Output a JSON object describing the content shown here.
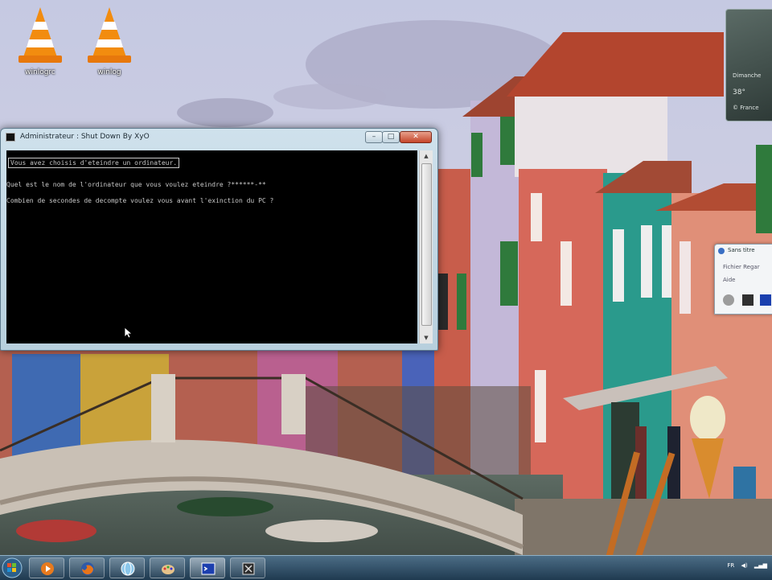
{
  "desktop": {
    "icons": [
      {
        "label": "winlogrc"
      },
      {
        "label": "winlog"
      }
    ]
  },
  "console": {
    "title": "Administrateur : Shut Down By XyO",
    "buttons": {
      "minimize": "–",
      "maximize": "□",
      "close": "✕"
    },
    "lines": [
      "Vous avez choisis d'eteindre un ordinateur.",
      "Quel est le nom de l'ordinateur que vous voulez eteindre ?******-**",
      "Combien de secondes de decompte voulez vous avant l'exinction du PC ?"
    ],
    "scroll_up": "▲",
    "scroll_down": "▼"
  },
  "gadget": {
    "clock_lines": [
      "Dimanche",
      "38°",
      "© France"
    ]
  },
  "paint_window": {
    "title": "Sans titre",
    "menu1": "Fichier    Regar",
    "menu2": "Aide",
    "swatches": [
      "#9c9c9c",
      "#303030",
      "#1a3fae"
    ]
  },
  "taskbar": {
    "tray_text": "FR"
  },
  "colors": {
    "vlc_orange": "#f28c0f",
    "console_bg": "#000000",
    "console_text": "#c8c8c8",
    "close_red": "#c4452a"
  }
}
